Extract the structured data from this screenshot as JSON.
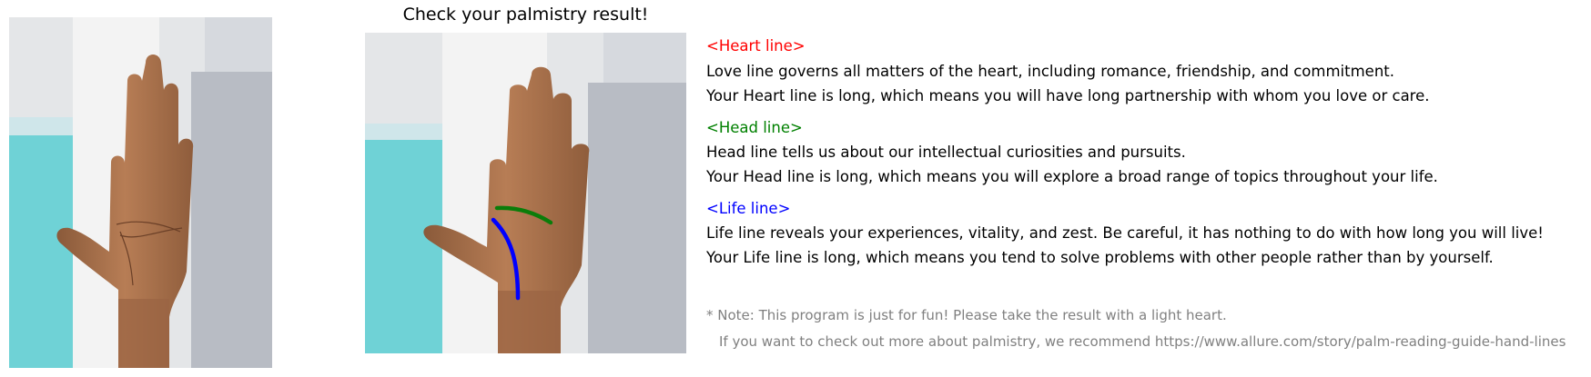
{
  "title": "Check your palmistry result!",
  "sections": {
    "heart": {
      "heading": "<Heart line>",
      "color": "#ff0000",
      "description": "Love line governs all matters of the heart, including romance, friendship, and commitment.",
      "result": "Your Heart line is long, which means you will have long partnership with whom you love or care."
    },
    "head": {
      "heading": "<Head line>",
      "color": "#008000",
      "description": "Head line tells us about our intellectual curiosities and pursuits.",
      "result": "Your Head line is long, which means you will explore a broad range of topics throughout your life."
    },
    "life": {
      "heading": "<Life line>",
      "color": "#0000ff",
      "description": "Life line reveals your experiences, vitality, and zest. Be careful, it has nothing to do with how long you will live!",
      "result": "Your Life line is long, which means you tend to solve problems with other people rather than by yourself."
    }
  },
  "note": {
    "line1": "* Note: This program is just for fun! Please take the result with a light heart.",
    "line2": "If you want to check out more about palmistry, we recommend https://www.allure.com/story/palm-reading-guide-hand-lines",
    "color": "#808080"
  }
}
